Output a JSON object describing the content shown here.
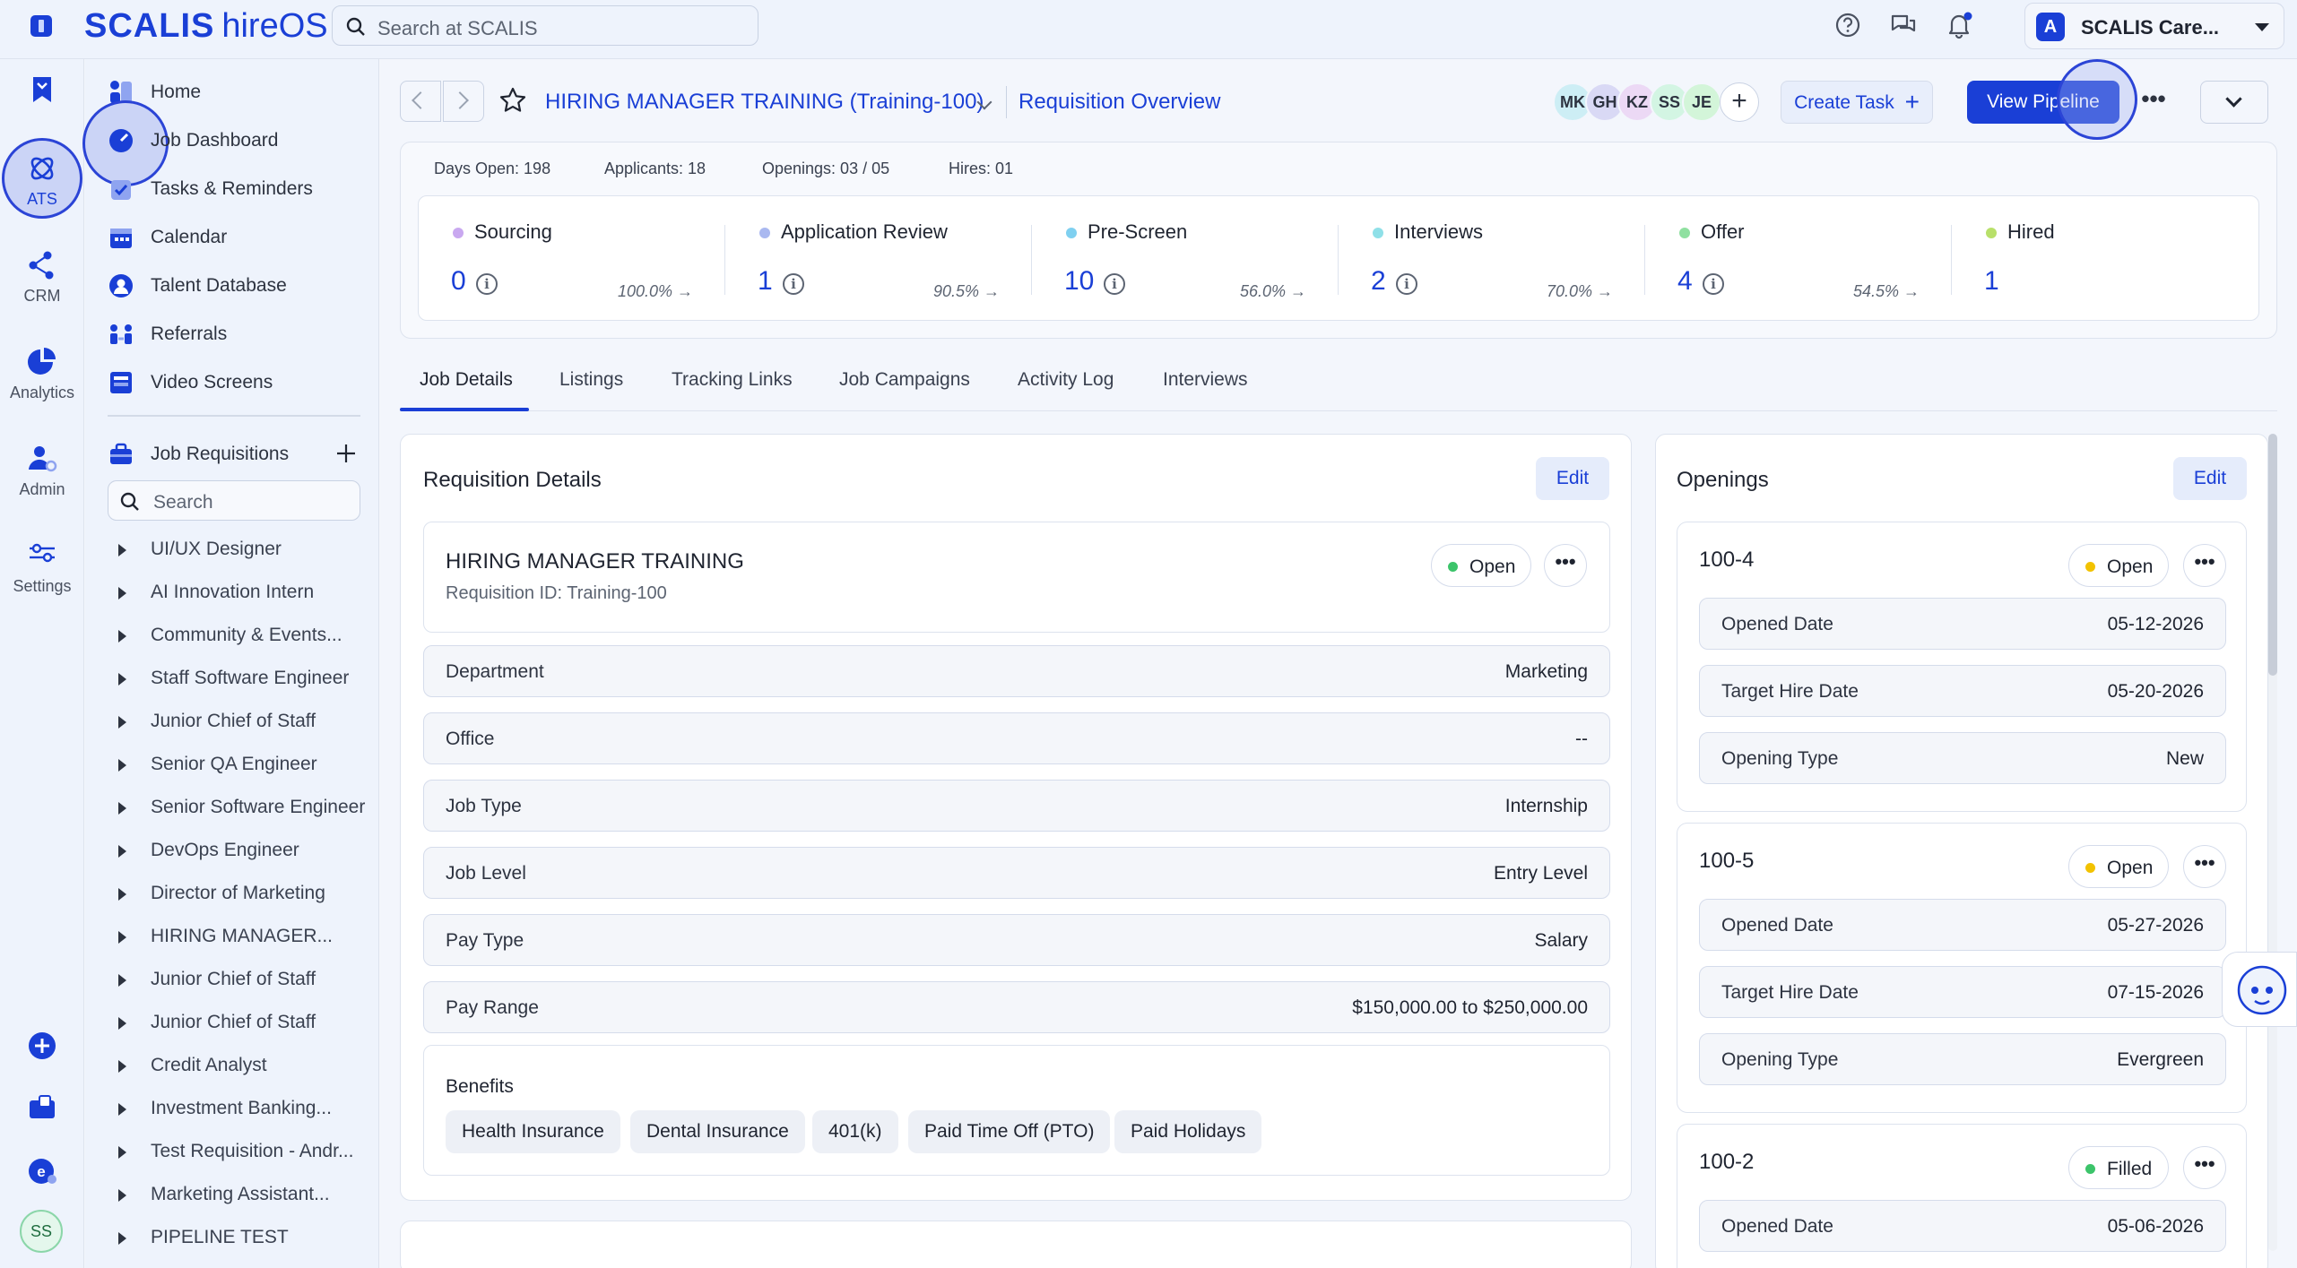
{
  "brand": {
    "name": "SCALIS",
    "product": "hireOS"
  },
  "search_top": {
    "placeholder": "Search at SCALIS"
  },
  "company": {
    "initial": "A",
    "name": "SCALIS Care..."
  },
  "rail": [
    {
      "label": "",
      "icon": "bookmark-icon"
    },
    {
      "label": "ATS",
      "icon": "ats-icon"
    },
    {
      "label": "CRM",
      "icon": "crm-icon"
    },
    {
      "label": "Analytics",
      "icon": "analytics-icon"
    },
    {
      "label": "Admin",
      "icon": "admin-icon"
    },
    {
      "label": "Settings",
      "icon": "settings-icon"
    }
  ],
  "user_initials": "SS",
  "sidebar": {
    "links": [
      {
        "label": "Home",
        "icon": "home-icon"
      },
      {
        "label": "Job Dashboard",
        "icon": "dashboard-icon"
      },
      {
        "label": "Tasks & Reminders",
        "icon": "tasks-icon"
      },
      {
        "label": "Calendar",
        "icon": "calendar-icon"
      },
      {
        "label": "Talent Database",
        "icon": "talent-icon"
      },
      {
        "label": "Referrals",
        "icon": "referrals-icon"
      },
      {
        "label": "Video Screens",
        "icon": "video-icon"
      }
    ],
    "requisitions_label": "Job Requisitions",
    "search_placeholder": "Search",
    "requisitions": [
      "UI/UX Designer",
      "AI Innovation Intern",
      "Community & Events...",
      "Staff Software Engineer",
      "Junior Chief of Staff",
      "Senior QA Engineer",
      "Senior Software Engineer",
      "DevOps Engineer",
      "Director of Marketing",
      "HIRING MANAGER...",
      "Junior Chief of Staff",
      "Junior Chief of Staff",
      "Credit Analyst",
      "Investment Banking...",
      "Test Requisition - Andr...",
      "Marketing Assistant...",
      "PIPELINE TEST"
    ]
  },
  "header": {
    "job_title": "HIRING MANAGER TRAINING (Training-100)",
    "section": "Requisition Overview",
    "avatars": [
      {
        "initials": "MK",
        "color": "#cdeef5"
      },
      {
        "initials": "GH",
        "color": "#d9d9f5"
      },
      {
        "initials": "KZ",
        "color": "#ecd9f5"
      },
      {
        "initials": "SS",
        "color": "#d3f5e3"
      },
      {
        "initials": "JE",
        "color": "#d3f5d9"
      }
    ],
    "create_task": "Create Task",
    "view_pipeline": "View Pipeline",
    "more": "•••"
  },
  "stats": {
    "days_open": "Days Open: 198",
    "applicants": "Applicants: 18",
    "openings": "Openings: 03 / 05",
    "hires": "Hires: 01"
  },
  "funnel": [
    {
      "name": "Sourcing",
      "count": "0",
      "pct": "100.0% →",
      "color": "#c9a8f0"
    },
    {
      "name": "Application Review",
      "count": "1",
      "pct": "90.5% →",
      "color": "#a9b8f0"
    },
    {
      "name": "Pre-Screen",
      "count": "10",
      "pct": "56.0% →",
      "color": "#7fd0f0"
    },
    {
      "name": "Interviews",
      "count": "2",
      "pct": "70.0% →",
      "color": "#8fe0e8"
    },
    {
      "name": "Offer",
      "count": "4",
      "pct": "54.5% →",
      "color": "#8fe0a0"
    },
    {
      "name": "Hired",
      "count": "1",
      "pct": "",
      "color": "#b8e06a"
    }
  ],
  "tabs": [
    "Job Details",
    "Listings",
    "Tracking Links",
    "Job Campaigns",
    "Activity Log",
    "Interviews"
  ],
  "requisition": {
    "title": "Requisition Details",
    "edit": "Edit",
    "job_name": "HIRING MANAGER TRAINING",
    "job_id": "Requisition ID: Training-100",
    "status": "Open",
    "rows": [
      {
        "label": "Department",
        "value": "Marketing"
      },
      {
        "label": "Office",
        "value": "--"
      },
      {
        "label": "Job Type",
        "value": "Internship"
      },
      {
        "label": "Job Level",
        "value": "Entry Level"
      },
      {
        "label": "Pay Type",
        "value": "Salary"
      },
      {
        "label": "Pay Range",
        "value": "$150,000.00 to $250,000.00"
      }
    ],
    "benefits_title": "Benefits",
    "benefits": [
      "Health Insurance",
      "Dental Insurance",
      "401(k)",
      "Paid Time Off (PTO)",
      "Paid Holidays"
    ]
  },
  "openings": {
    "title": "Openings",
    "edit": "Edit",
    "items": [
      {
        "id": "100-4",
        "status": "Open",
        "status_color": "#f2c200",
        "rows": [
          {
            "label": "Opened Date",
            "value": "05-12-2026"
          },
          {
            "label": "Target Hire Date",
            "value": "05-20-2026"
          },
          {
            "label": "Opening Type",
            "value": "New"
          }
        ]
      },
      {
        "id": "100-5",
        "status": "Open",
        "status_color": "#f2c200",
        "rows": [
          {
            "label": "Opened Date",
            "value": "05-27-2026"
          },
          {
            "label": "Target Hire Date",
            "value": "07-15-2026"
          },
          {
            "label": "Opening Type",
            "value": "Evergreen"
          }
        ]
      },
      {
        "id": "100-2",
        "status": "Filled",
        "status_color": "#3cc46a",
        "rows": [
          {
            "label": "Opened Date",
            "value": "05-06-2026"
          }
        ]
      }
    ]
  }
}
